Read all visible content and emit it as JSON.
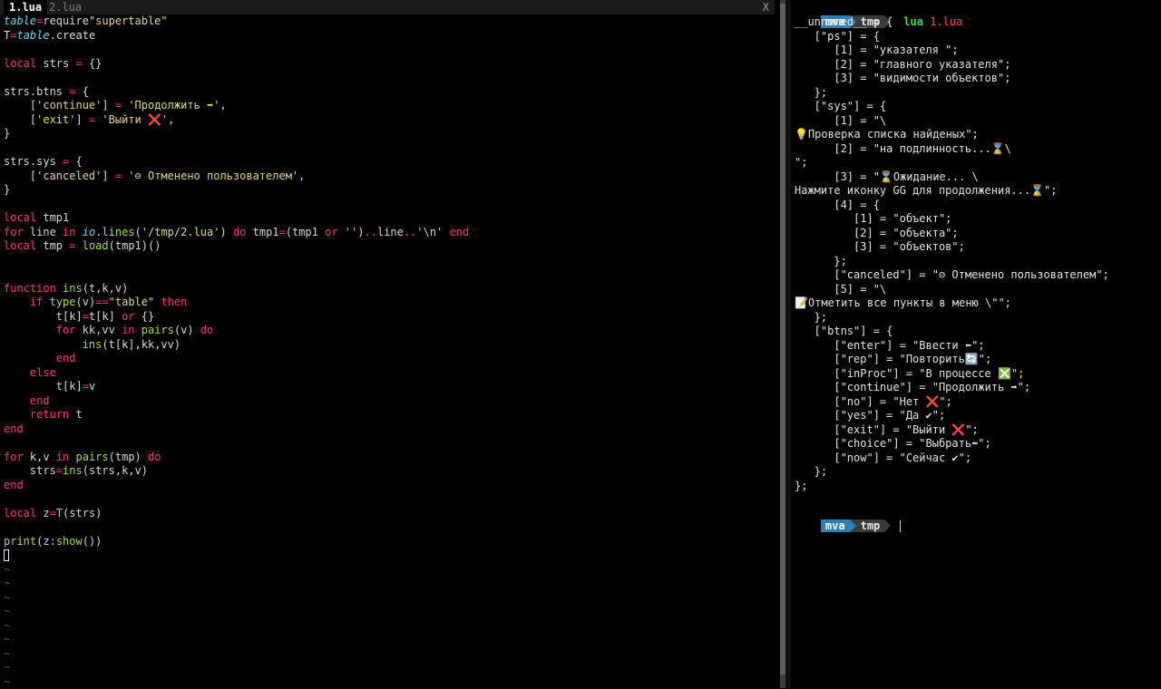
{
  "colors": {
    "keyword": "#ff2f7e",
    "string": "#e6db74",
    "builtin": "#a6e22e",
    "italic": "#66d9ef",
    "purple": "#ae81ff",
    "operator": "#ff2f7e",
    "plain": "#d8d8d8",
    "prompt_user": "#2c7fb0",
    "prompt_dir": "#3a3a3a",
    "command": "#44d94a",
    "argument": "#ff4a4a"
  },
  "editor": {
    "tabs": [
      {
        "label": "1.lua",
        "active": true
      },
      {
        "label": "2.lua",
        "active": false
      }
    ],
    "close_glyph": "X",
    "lines": [
      [
        [
          "italic",
          "table"
        ],
        [
          "op",
          "="
        ],
        [
          "p",
          "require"
        ],
        [
          "str",
          "\"supertable\""
        ]
      ],
      [
        [
          "p",
          "T"
        ],
        [
          "op",
          "="
        ],
        [
          "italic",
          "table"
        ],
        [
          "p",
          ".create"
        ]
      ],
      [],
      [
        [
          "kw",
          "local"
        ],
        [
          "p",
          " strs "
        ],
        [
          "op",
          "="
        ],
        [
          "p",
          " {}"
        ]
      ],
      [],
      [
        [
          "p",
          "strs.btns "
        ],
        [
          "op",
          "="
        ],
        [
          "p",
          " {"
        ]
      ],
      [
        [
          "p",
          "    ["
        ],
        [
          "str",
          "'continue'"
        ],
        [
          "p",
          "] "
        ],
        [
          "op",
          "="
        ],
        [
          "p",
          " "
        ],
        [
          "str",
          "'Продолжить ➡'"
        ],
        [
          "p",
          ","
        ]
      ],
      [
        [
          "p",
          "    ["
        ],
        [
          "str",
          "'exit'"
        ],
        [
          "p",
          "] "
        ],
        [
          "op",
          "="
        ],
        [
          "p",
          " "
        ],
        [
          "str",
          "'Выйти ❌'"
        ],
        [
          "p",
          ","
        ]
      ],
      [
        [
          "p",
          "}"
        ]
      ],
      [],
      [
        [
          "p",
          "strs.sys "
        ],
        [
          "op",
          "="
        ],
        [
          "p",
          " {"
        ]
      ],
      [
        [
          "p",
          "    ["
        ],
        [
          "str",
          "'canceled'"
        ],
        [
          "p",
          "] "
        ],
        [
          "op",
          "="
        ],
        [
          "p",
          " "
        ],
        [
          "str",
          "'⊖ Отменено пользователем'"
        ],
        [
          "p",
          ","
        ]
      ],
      [
        [
          "p",
          "}"
        ]
      ],
      [],
      [
        [
          "kw",
          "local"
        ],
        [
          "p",
          " tmp1"
        ]
      ],
      [
        [
          "kw",
          "for"
        ],
        [
          "p",
          " line "
        ],
        [
          "kw",
          "in"
        ],
        [
          "p",
          " "
        ],
        [
          "italic",
          "io"
        ],
        [
          "p",
          "."
        ],
        [
          "bi",
          "lines"
        ],
        [
          "p",
          "("
        ],
        [
          "str",
          "'/tmp/2.lua'"
        ],
        [
          "p",
          ") "
        ],
        [
          "kw",
          "do"
        ],
        [
          "p",
          " tmp1"
        ],
        [
          "op",
          "="
        ],
        [
          "p",
          "(tmp1 "
        ],
        [
          "kw",
          "or"
        ],
        [
          "p",
          " "
        ],
        [
          "str",
          "''"
        ],
        [
          "p",
          ")"
        ],
        [
          "op",
          ".."
        ],
        [
          "p",
          "line"
        ],
        [
          "op",
          ".."
        ],
        [
          "str",
          "'\\n'"
        ],
        [
          "p",
          " "
        ],
        [
          "kw",
          "end"
        ]
      ],
      [
        [
          "kw",
          "local"
        ],
        [
          "p",
          " tmp "
        ],
        [
          "op",
          "="
        ],
        [
          "p",
          " "
        ],
        [
          "bi",
          "load"
        ],
        [
          "p",
          "(tmp1)()"
        ]
      ],
      [],
      [],
      [
        [
          "kw",
          "function"
        ],
        [
          "p",
          " "
        ],
        [
          "bi",
          "ins"
        ],
        [
          "p",
          "(t,k,v)"
        ]
      ],
      [
        [
          "p",
          "    "
        ],
        [
          "kw",
          "if"
        ],
        [
          "p",
          " "
        ],
        [
          "bi",
          "type"
        ],
        [
          "p",
          "(v)"
        ],
        [
          "op",
          "=="
        ],
        [
          "str",
          "\"table\""
        ],
        [
          "p",
          " "
        ],
        [
          "kw",
          "then"
        ]
      ],
      [
        [
          "p",
          "        t[k]"
        ],
        [
          "op",
          "="
        ],
        [
          "p",
          "t[k] "
        ],
        [
          "kw",
          "or"
        ],
        [
          "p",
          " {}"
        ]
      ],
      [
        [
          "p",
          "        "
        ],
        [
          "kw",
          "for"
        ],
        [
          "p",
          " kk,vv "
        ],
        [
          "kw",
          "in"
        ],
        [
          "p",
          " "
        ],
        [
          "bi",
          "pairs"
        ],
        [
          "p",
          "(v) "
        ],
        [
          "kw",
          "do"
        ]
      ],
      [
        [
          "p",
          "            "
        ],
        [
          "bi",
          "ins"
        ],
        [
          "p",
          "(t[k],kk,vv)"
        ]
      ],
      [
        [
          "p",
          "        "
        ],
        [
          "kw",
          "end"
        ]
      ],
      [
        [
          "p",
          "    "
        ],
        [
          "kw",
          "else"
        ]
      ],
      [
        [
          "p",
          "        t[k]"
        ],
        [
          "op",
          "="
        ],
        [
          "p",
          "v"
        ]
      ],
      [
        [
          "p",
          "    "
        ],
        [
          "kw",
          "end"
        ]
      ],
      [
        [
          "p",
          "    "
        ],
        [
          "kw",
          "return"
        ],
        [
          "p",
          " t"
        ]
      ],
      [
        [
          "kw",
          "end"
        ]
      ],
      [],
      [
        [
          "kw",
          "for"
        ],
        [
          "p",
          " k,v "
        ],
        [
          "kw",
          "in"
        ],
        [
          "p",
          " "
        ],
        [
          "bi",
          "pairs"
        ],
        [
          "p",
          "(tmp) "
        ],
        [
          "kw",
          "do"
        ]
      ],
      [
        [
          "p",
          "    strs"
        ],
        [
          "op",
          "="
        ],
        [
          "bi",
          "ins"
        ],
        [
          "p",
          "(strs,k,v)"
        ]
      ],
      [
        [
          "kw",
          "end"
        ]
      ],
      [],
      [
        [
          "kw",
          "local"
        ],
        [
          "p",
          " z"
        ],
        [
          "op",
          "="
        ],
        [
          "bi",
          "T"
        ],
        [
          "p",
          "(strs)"
        ]
      ],
      [],
      [
        [
          "bi",
          "print"
        ],
        [
          "p",
          "(z:"
        ],
        [
          "bi",
          "show"
        ],
        [
          "p",
          "())"
        ]
      ],
      [
        [
          "cursor",
          ""
        ]
      ]
    ],
    "tilde": "~",
    "tilde_count": 9
  },
  "terminal": {
    "prompt1": {
      "user": "mva",
      "dir": "tmp",
      "command": "lua",
      "argument": "1.lua"
    },
    "output_lines": [
      "__unnamed__ = {",
      "   [\"ps\"] = {",
      "      [1] = \"указателя \";",
      "      [2] = \"главного указателя\";",
      "      [3] = \"видимости объектов\";",
      "   };",
      "   [\"sys\"] = {",
      "      [1] = \"\\",
      "💡Проверка списка найденых\";",
      "      [2] = \"на подлинность...⌛\\",
      "\";",
      "      [3] = \"⌛Ожидание... \\",
      "Нажмите иконку GG для продолжения...⌛\";",
      "      [4] = {",
      "         [1] = \"объект\";",
      "         [2] = \"объекта\";",
      "         [3] = \"объектов\";",
      "      };",
      "      [\"canceled\"] = \"⊖ Отменено пользователем\";",
      "      [5] = \"\\",
      "📝Отметить все пункты в меню \\\"\";",
      "   };",
      "   [\"btns\"] = {",
      "      [\"enter\"] = \"Ввести ⬅\";",
      "      [\"rep\"] = \"Повторить🔄\";",
      "      [\"inProc\"] = \"В процессе ❎\";",
      "      [\"continue\"] = \"Продолжить ➡\";",
      "      [\"no\"] = \"Нет ❌\";",
      "      [\"yes\"] = \"Да ✔\";",
      "      [\"exit\"] = \"Выйти ❌\";",
      "      [\"choice\"] = \"Выбрать⬅\";",
      "      [\"now\"] = \"Сейчас ✔\";",
      "   };",
      "};"
    ],
    "prompt2": {
      "user": "mva",
      "dir": "tmp"
    }
  }
}
